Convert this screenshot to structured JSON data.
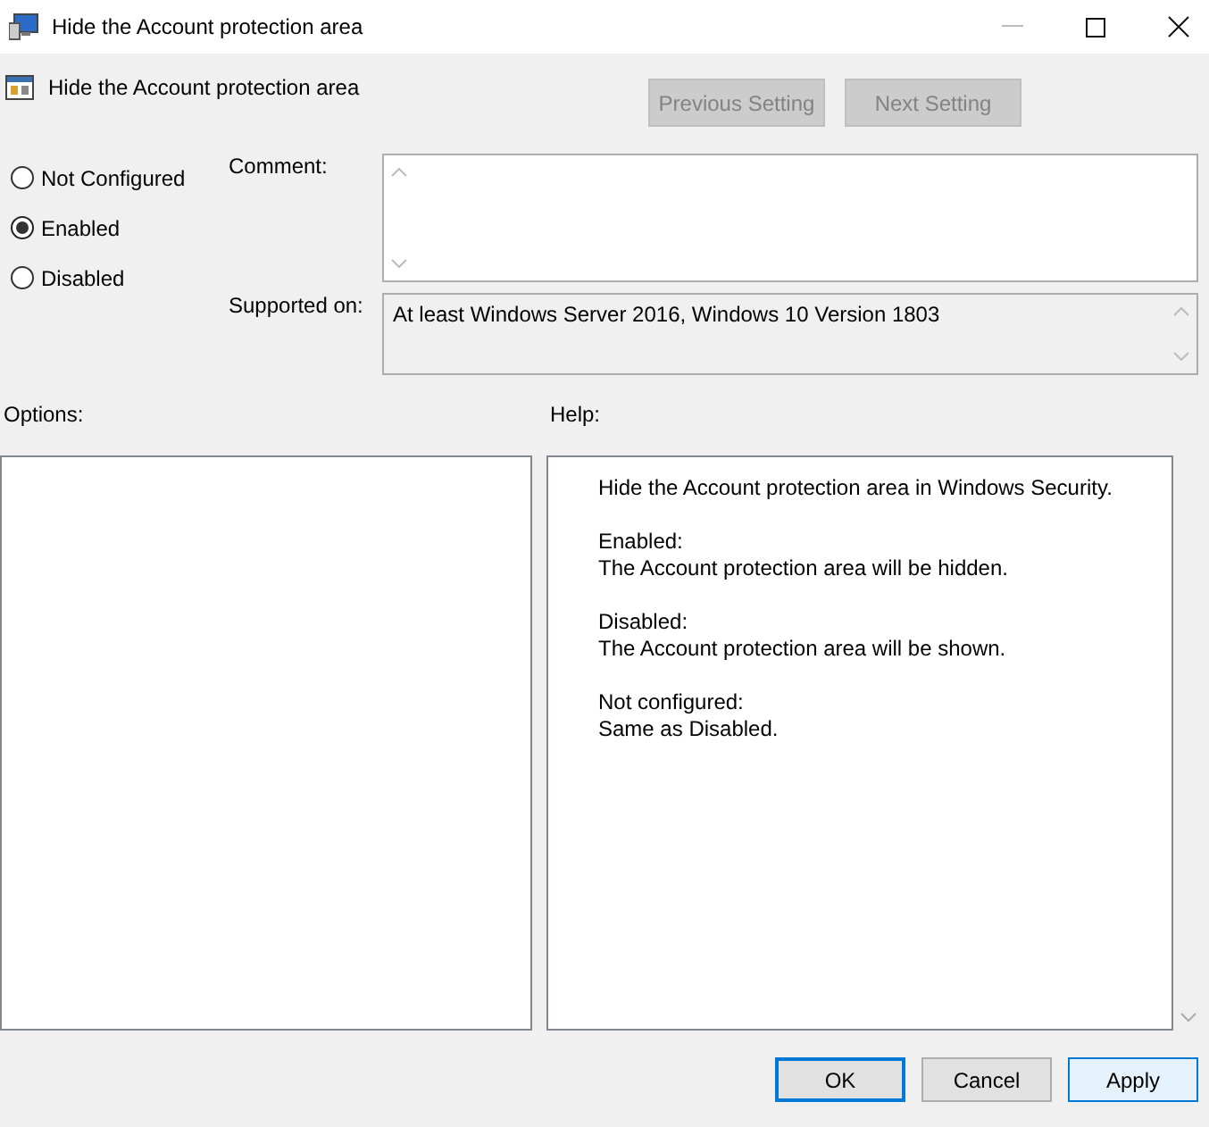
{
  "window": {
    "title": "Hide the Account protection area"
  },
  "header": {
    "title": "Hide the Account protection area",
    "nav_buttons": [
      {
        "label": "Previous Setting",
        "disabled": true
      },
      {
        "label": "Next Setting",
        "disabled": true
      }
    ]
  },
  "state_options": [
    {
      "label": "Not Configured",
      "selected": false
    },
    {
      "label": "Enabled",
      "selected": true
    },
    {
      "label": "Disabled",
      "selected": false
    }
  ],
  "comment": {
    "label": "Comment:"
  },
  "supported_on": {
    "label": "Supported on:",
    "value": "At least Windows Server 2016, Windows 10 Version 1803"
  },
  "options": {
    "label": "Options:"
  },
  "help": {
    "label": "Help:",
    "paragraphs": [
      [
        "Hide the Account protection area in Windows Security."
      ],
      [
        "Enabled:",
        "The Account protection area will be hidden."
      ],
      [
        "Disabled:",
        "The Account protection area will be shown."
      ],
      [
        "Not configured:",
        "Same as Disabled."
      ]
    ]
  },
  "buttons": [
    {
      "label": "OK",
      "kind": "default"
    },
    {
      "label": "Cancel",
      "kind": "normal"
    },
    {
      "label": "Apply",
      "kind": "hover"
    }
  ]
}
